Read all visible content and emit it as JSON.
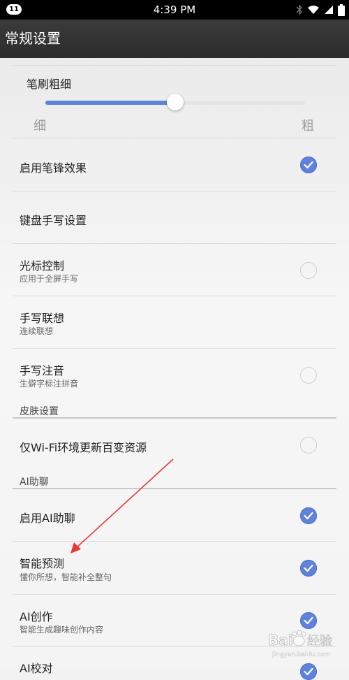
{
  "status_bar": {
    "notification_count": "11",
    "time": "4:39 PM",
    "icons": [
      "bluetooth-icon",
      "wifi-icon",
      "signal-icon",
      "battery-icon"
    ]
  },
  "app_bar": {
    "title": "常规设置"
  },
  "brush": {
    "label": "笔刷粗细",
    "min_label": "细",
    "max_label": "粗",
    "level": 0.5
  },
  "settings": {
    "pen_tip": {
      "label": "启用笔锋效果",
      "checked": true
    },
    "keyboard_hw": {
      "label": "键盘手写设置"
    },
    "cursor": {
      "label": "光标控制",
      "sub": "应用于全屏手写",
      "checked": false
    },
    "association": {
      "label": "手写联想",
      "sub": "连续联想"
    },
    "phonetic": {
      "label": "手写注音",
      "sub": "生僻字标注拼音",
      "checked": false
    },
    "skin_section": {
      "title": "皮肤设置"
    },
    "wifi_update": {
      "label": "仅Wi-Fi环境更新百变资源",
      "checked": false
    },
    "ai_section": {
      "title": "AI助聊"
    },
    "ai_enable": {
      "label": "启用AI助聊",
      "checked": true
    },
    "smart_predict": {
      "label": "智能预测",
      "sub": "懂你所想，智能补全整句",
      "checked": true
    },
    "ai_create": {
      "label": "AI创作",
      "sub": "智能生成趣味创作内容",
      "checked": true
    },
    "ai_proofread": {
      "label": "AI校对",
      "checked": true
    }
  },
  "colors": {
    "accent": "#5f82dc",
    "annotation_arrow": "#e53935",
    "app_bar": "#333333"
  },
  "watermark": {
    "text": "Bai 经验",
    "sub": "jingyan.baidu.com"
  }
}
